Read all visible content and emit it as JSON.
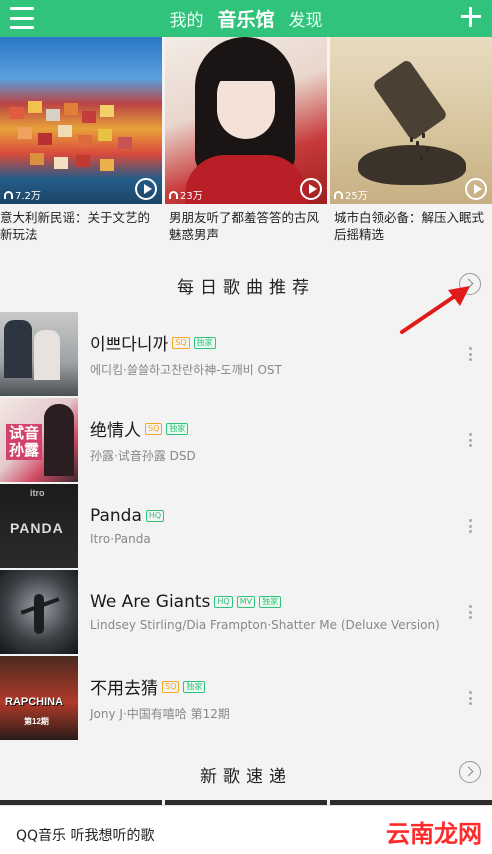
{
  "colors": {
    "brand": "#31c27c",
    "tag_sq": "#f5a623",
    "tag_green": "#31c27c"
  },
  "header": {
    "menu_icon": "hamburger-menu-icon",
    "tabs": [
      {
        "label": "我的",
        "active": false
      },
      {
        "label": "音乐馆",
        "active": true
      },
      {
        "label": "发现",
        "active": false
      }
    ],
    "add_icon": "plus-icon"
  },
  "banners": [
    {
      "plays": "7.2万",
      "caption": "意大利新民谣：关于文艺的新玩法"
    },
    {
      "plays": "23万",
      "caption": "男朋友听了都羞答答的古风魅惑男声"
    },
    {
      "plays": "25万",
      "caption": "城市白领必备：解压入眠式后摇精选"
    }
  ],
  "daily": {
    "title": "每日歌曲推荐"
  },
  "songs": [
    {
      "name": "이쁘다니까",
      "tags": [
        "SQ",
        "独家"
      ],
      "meta": "에디킴·쓸쓸하고찬란하神-도깨비 OST"
    },
    {
      "name": "绝情人",
      "tags": [
        "SQ",
        "独家"
      ],
      "meta": "孙露·试音孙露 DSD"
    },
    {
      "name": "Panda",
      "tags": [
        "HQ"
      ],
      "meta": "Itro·Panda"
    },
    {
      "name": "We Are Giants",
      "tags": [
        "HQ",
        "MV",
        "独家"
      ],
      "meta": "Lindsey Stirling/Dia Frampton·Shatter Me (Deluxe Version)"
    },
    {
      "name": "不用去猜",
      "tags": [
        "SQ",
        "独家"
      ],
      "meta": "Jony J·中国有嘻哈 第12期"
    }
  ],
  "covers": {
    "c2_text": "试音\n孙露",
    "c3_text": "PANDA",
    "c3_top": "itro",
    "c5_text": "RAPCHINA",
    "c5_sub": "第12期"
  },
  "new_songs": {
    "title": "新歌速递"
  },
  "bottom": {
    "text": "QQ音乐 听我想听的歌"
  },
  "watermark": {
    "text": "云南龙网"
  }
}
